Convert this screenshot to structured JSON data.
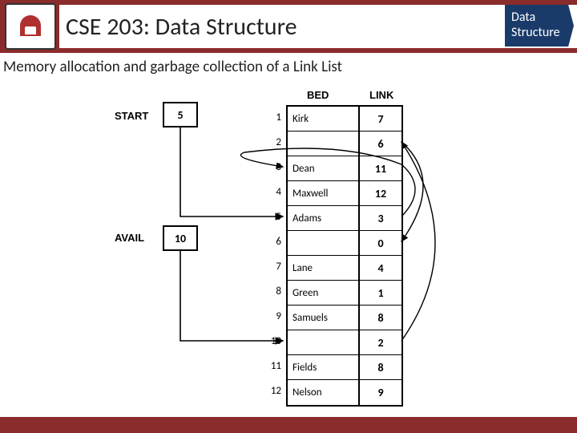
{
  "header": {
    "title": "CSE 203: Data Structure",
    "badge_line1": "Data",
    "badge_line2": "Structure"
  },
  "subtitle": "Memory allocation and garbage collection of a Link List",
  "diagram": {
    "start_label": "START",
    "start_value": "5",
    "avail_label": "AVAIL",
    "avail_value": "10",
    "col_bed": "BED",
    "col_link": "LINK",
    "rows": [
      {
        "n": "1",
        "bed": "Kirk",
        "link": "7"
      },
      {
        "n": "2",
        "bed": "",
        "link": "6"
      },
      {
        "n": "3",
        "bed": "Dean",
        "link": "11"
      },
      {
        "n": "4",
        "bed": "Maxwell",
        "link": "12"
      },
      {
        "n": "5",
        "bed": "Adams",
        "link": "3"
      },
      {
        "n": "6",
        "bed": "",
        "link": "0"
      },
      {
        "n": "7",
        "bed": "Lane",
        "link": "4"
      },
      {
        "n": "8",
        "bed": "Green",
        "link": "1"
      },
      {
        "n": "9",
        "bed": "Samuels",
        "link": "8"
      },
      {
        "n": "10",
        "bed": "",
        "link": "2"
      },
      {
        "n": "11",
        "bed": "Fields",
        "link": "8"
      },
      {
        "n": "12",
        "bed": "Nelson",
        "link": "9"
      }
    ]
  }
}
